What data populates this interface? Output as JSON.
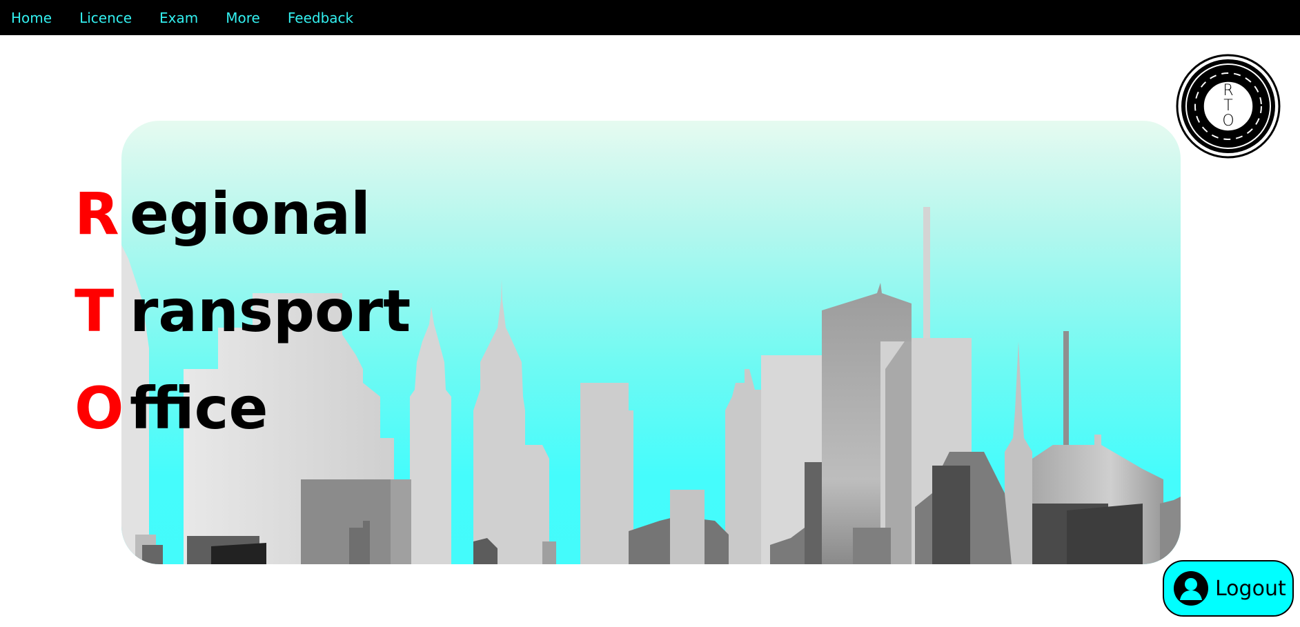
{
  "nav": {
    "items": [
      {
        "label": "Home"
      },
      {
        "label": "Licence"
      },
      {
        "label": "Exam"
      },
      {
        "label": "More"
      },
      {
        "label": "Feedback"
      }
    ]
  },
  "logo": {
    "letters": [
      "R",
      "T",
      "O"
    ],
    "icon": "rto-road-badge-icon"
  },
  "hero": {
    "lines": [
      {
        "initial": "R",
        "rest": "egional"
      },
      {
        "initial": "T",
        "rest": "ransport"
      },
      {
        "initial": "O",
        "rest": "ffice"
      }
    ],
    "background_image": "city-skyline-icon"
  },
  "logout": {
    "label": "Logout",
    "icon": "user-avatar-icon"
  },
  "colors": {
    "nav_bg": "#000000",
    "nav_text": "#33f0f0",
    "accent_red": "#ff0000",
    "logout_bg": "#00ffff",
    "sky_top": "#e6faf0",
    "sky_bottom": "#44fbfb"
  }
}
